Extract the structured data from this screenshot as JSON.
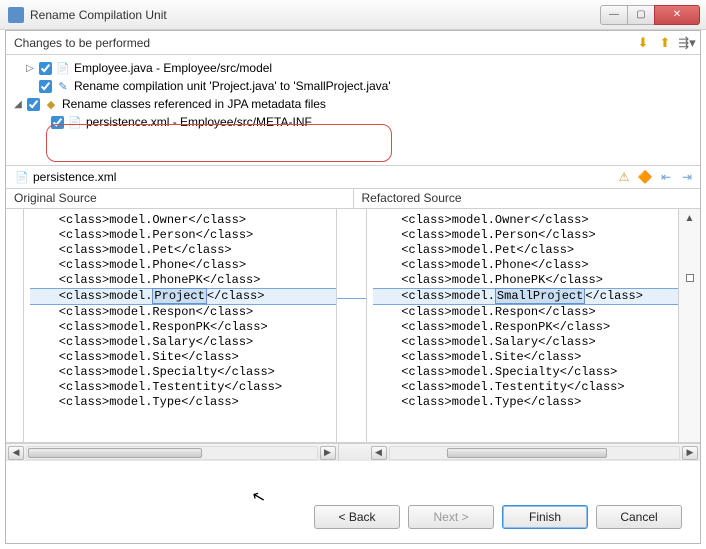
{
  "window": {
    "title": "Rename Compilation Unit"
  },
  "changes": {
    "header": "Changes to be performed",
    "items": [
      {
        "label": "Employee.java - Employee/src/model",
        "expander": "▷",
        "icon_name": "java-file-icon"
      },
      {
        "label": "Rename compilation unit 'Project.java' to 'SmallProject.java'",
        "expander": "",
        "icon_name": "rename-icon"
      },
      {
        "label": "Rename classes referenced in JPA metadata files",
        "expander": "◢",
        "icon_name": "jpa-icon"
      },
      {
        "label": "persistence.xml - Employee/src/META-INF",
        "expander": "",
        "icon_name": "xml-file-icon"
      }
    ]
  },
  "filebar": {
    "name": "persistence.xml"
  },
  "diff": {
    "left_header": "Original Source",
    "right_header": "Refactored Source",
    "lines": {
      "pre": [
        "<class>model.Owner</class>",
        "<class>model.Person</class>",
        "<class>model.Pet</class>",
        "<class>model.Phone</class>",
        "<class>model.PhonePK</class>"
      ],
      "changed_old": "<class>model.Project</class>",
      "changed_new": "<class>model.SmallProject</class>",
      "changed_token_old": "Project",
      "changed_token_new": "SmallProject",
      "post": [
        "<class>model.Respon</class>",
        "<class>model.ResponPK</class>",
        "<class>model.Salary</class>",
        "<class>model.Site</class>",
        "<class>model.Specialty</class>",
        "<class>model.Testentity</class>",
        "<class>model.Type</class>"
      ]
    }
  },
  "buttons": {
    "back": "< Back",
    "next": "Next >",
    "finish": "Finish",
    "cancel": "Cancel"
  }
}
